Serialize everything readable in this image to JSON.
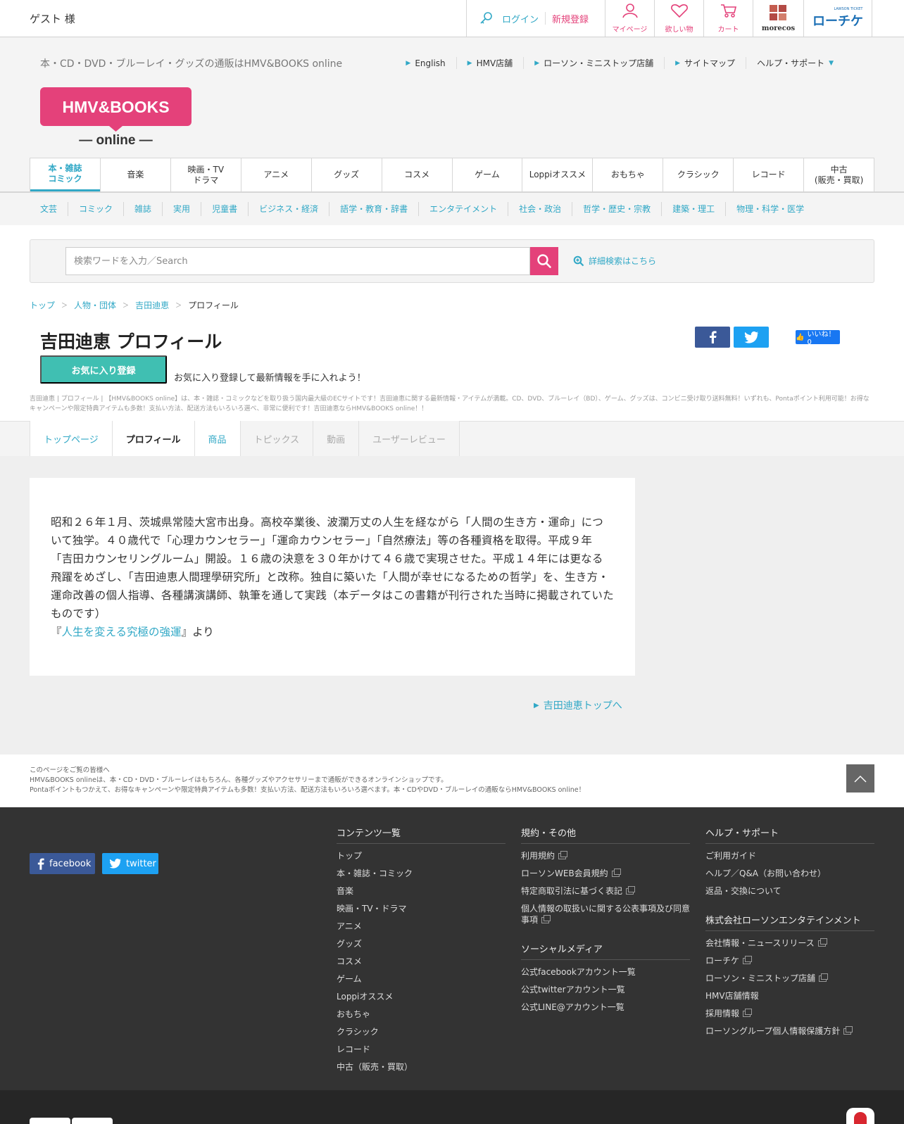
{
  "topbar": {
    "guest": "ゲスト 様",
    "login": "ログイン",
    "register": "新規登録",
    "icons": [
      {
        "name": "mypage-icon",
        "label": "マイページ"
      },
      {
        "name": "heart-icon",
        "label": "欲しい物"
      },
      {
        "name": "cart-icon",
        "label": "カート"
      }
    ],
    "morecos": "morecos",
    "loppi_ticket": "ローチケ",
    "loppi_small": "LAWSON TICKET",
    "accent_pink": "#e4417a",
    "accent_blue": "#31a8c6"
  },
  "header": {
    "tagline": "本・CD・DVD・ブルーレイ・グッズの通販はHMV&BOOKS online",
    "links": [
      "English",
      "HMV店舗",
      "ローソン・ミニストップ店舗",
      "サイトマップ",
      "ヘルプ・サポート"
    ],
    "logo_main": "HMV&BOOKS",
    "logo_sub": "— online —",
    "logo_color": "#e4417a"
  },
  "mainnav": [
    {
      "l1": "本・雑誌",
      "l2": "コミック"
    },
    {
      "l1": "音楽",
      "l2": ""
    },
    {
      "l1": "映画・TV",
      "l2": "ドラマ"
    },
    {
      "l1": "アニメ",
      "l2": ""
    },
    {
      "l1": "グッズ",
      "l2": ""
    },
    {
      "l1": "コスメ",
      "l2": ""
    },
    {
      "l1": "ゲーム",
      "l2": ""
    },
    {
      "l1": "Loppiオススメ",
      "l2": ""
    },
    {
      "l1": "おもちゃ",
      "l2": ""
    },
    {
      "l1": "クラシック",
      "l2": ""
    },
    {
      "l1": "レコード",
      "l2": ""
    },
    {
      "l1": "中古",
      "l2": "(販売・買取)"
    }
  ],
  "subnav": [
    "文芸",
    "コミック",
    "雑誌",
    "実用",
    "児童書",
    "ビジネス・経済",
    "語学・教育・辞書",
    "エンタテイメント",
    "社会・政治",
    "哲学・歴史・宗教",
    "建築・理工",
    "物理・科学・医学"
  ],
  "search": {
    "placeholder": "検索ワードを入力／Search",
    "advanced": "詳細検索はこちら"
  },
  "breadcrumb": [
    "トップ",
    "人物・団体",
    "吉田迪恵",
    "プロフィール"
  ],
  "page": {
    "title": "吉田迪恵 プロフィール",
    "fav_button": "お気に入り登録",
    "fav_text": "お気に入り登録して最新情報を手に入れよう！",
    "like_label": "いいね！ 0",
    "meta": "吉田迪恵 | プロフィール | 【HMV&BOOKS online】は、本・雑誌・コミックなどを取り扱う国内最大級のECサイトです！吉田迪恵に関する最新情報・アイテムが満載。CD、DVD、ブルーレイ（BD）、ゲーム、グッズは、コンビニ受け取り送料無料！いずれも、Pontaポイント利用可能！お得なキャンペーンや限定特典アイテムも多数！支払い方法、配送方法もいろいろ選べ、非常に便利です！吉田迪恵ならHMV&BOOKS online！！"
  },
  "tabs": [
    {
      "label": "トップページ",
      "state": "link"
    },
    {
      "label": "プロフィール",
      "state": "current"
    },
    {
      "label": "商品",
      "state": "link"
    },
    {
      "label": "トピックス",
      "state": "disabled"
    },
    {
      "label": "動画",
      "state": "disabled"
    },
    {
      "label": "ユーザーレビュー",
      "state": "disabled"
    }
  ],
  "profile": {
    "text": "昭和２６年１月、茨城県常陸大宮市出身。高校卒業後、波瀾万丈の人生を経ながら「人間の生き方・運命」について独学。４０歳代で「心理カウンセラー」「運命カウンセラー」「自然療法」等の各種資格を取得。平成９年「吉田カウンセリングルーム」開設。１６歳の決意を３０年かけて４６歳で実現させた。平成１４年には更なる飛躍をめざし、「吉田迪恵人間理學研究所」と改称。独自に築いた「人間が幸せになるための哲学」を、生き方・運命改善の個人指導、各種講演講師、執筆を通して実践（本データはこの書籍が刊行された当時に掲載されていたものです）",
    "source_open": "『",
    "source_book": "人生を変える究極の強運",
    "source_close": "』より",
    "top_link": "吉田迪恵トップへ"
  },
  "notice": {
    "l1": "このページをご覧の皆様へ",
    "l2": "HMV&BOOKS onlineは、本・CD・DVD・ブルーレイはもちろん、各種グッズやアクセサリーまで通販ができるオンラインショップです。",
    "l3": "Pontaポイントもつかえて、お得なキャンペーンや限定特典アイテムも多数！支払い方法、配送方法もいろいろ選べます。本・CDやDVD・ブルーレイの通販ならHMV&BOOKS online！"
  },
  "footer": {
    "facebook": "facebook",
    "twitter": "twitter",
    "contents_head": "コンテンツ一覧",
    "contents": [
      "トップ",
      "本・雑誌・コミック",
      "音楽",
      "映画・TV・ドラマ",
      "アニメ",
      "グッズ",
      "コスメ",
      "ゲーム",
      "Loppiオススメ",
      "おもちゃ",
      "クラシック",
      "レコード",
      "中古（販売・買取）"
    ],
    "terms_head": "規約・その他",
    "terms": [
      "利用規約",
      "ローソンWEB会員規約",
      "特定商取引法に基づく表記",
      "個人情報の取扱いに関する公表事項及び同意事項"
    ],
    "social_head": "ソーシャルメディア",
    "social": [
      "公式facebookアカウント一覧",
      "公式twitterアカウント一覧",
      "公式LINE@アカウント一覧"
    ],
    "help_head": "ヘルプ・サポート",
    "help": [
      "ご利用ガイド",
      "ヘルプ／Q&A（お問い合わせ）",
      "返品・交換について"
    ],
    "company_head": "株式会社ローソンエンタテインメント",
    "company": [
      "会社情報・ニュースリリース",
      "ローチケ",
      "ローソン・ミニストップ店舗",
      "HMV店舗情報",
      "採用情報",
      "ローソングループ個人情報保護方針"
    ]
  }
}
